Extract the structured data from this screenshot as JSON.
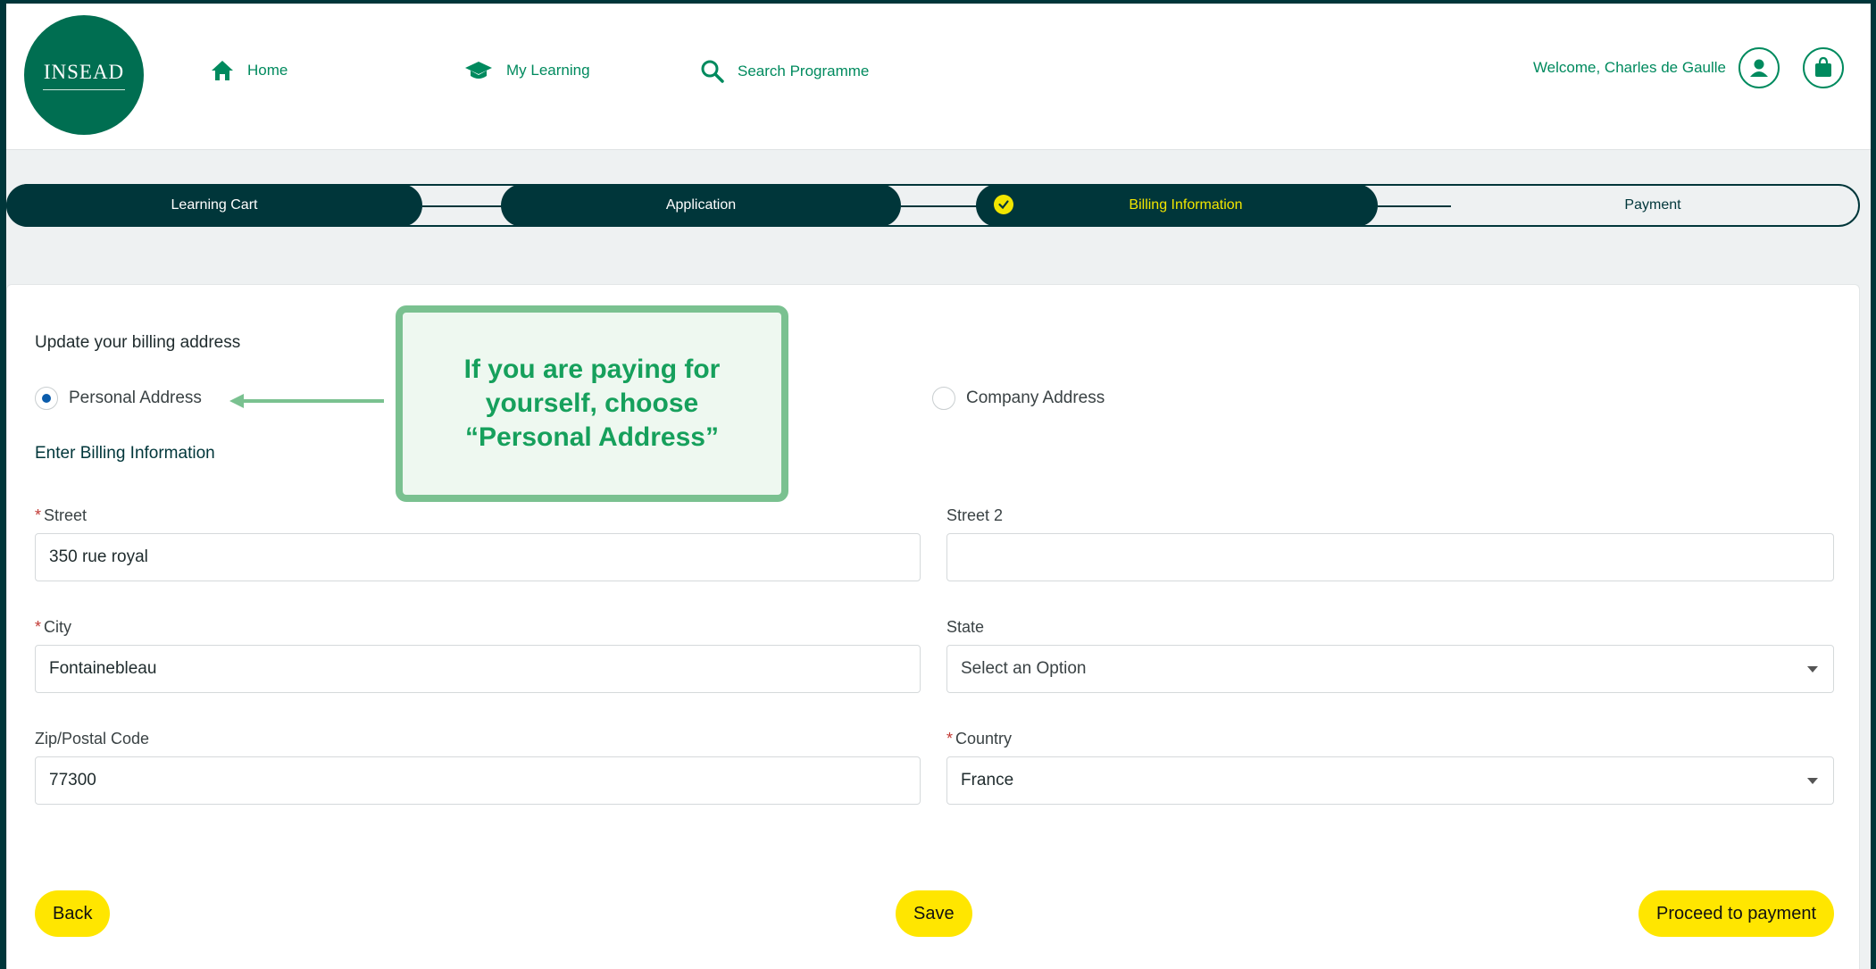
{
  "header": {
    "logo_text": "INSEAD",
    "nav": {
      "home": "Home",
      "my_learning": "My Learning",
      "search": "Search Programme"
    },
    "welcome": "Welcome, Charles de Gaulle"
  },
  "stepper": {
    "steps": [
      "Learning Cart",
      "Application",
      "Billing Information",
      "Payment"
    ],
    "active_index": 2
  },
  "form": {
    "title": "Update your billing address",
    "address_types": {
      "personal": "Personal Address",
      "company": "Company Address",
      "selected": "Personal Address"
    },
    "subtitle": "Enter Billing Information",
    "fields": {
      "street": {
        "label": "Street",
        "value": "350 rue royal",
        "required": true
      },
      "street2": {
        "label": "Street 2",
        "value": "",
        "required": false
      },
      "city": {
        "label": "City",
        "value": "Fontainebleau",
        "required": true
      },
      "state": {
        "label": "State",
        "value": "Select an Option",
        "required": false
      },
      "zip": {
        "label": "Zip/Postal Code",
        "value": "77300",
        "required": false
      },
      "country": {
        "label": "Country",
        "value": "France",
        "required": true
      }
    },
    "required_marker": "*"
  },
  "buttons": {
    "back": "Back",
    "save": "Save",
    "proceed": "Proceed to payment"
  },
  "callout": {
    "text": "If you are paying for yourself, choose “Personal Address”"
  },
  "colors": {
    "brand_dark": "#00363a",
    "brand_green": "#006e51",
    "link_green": "#008a5e",
    "accent_yellow": "#ffe600",
    "annotation_green": "#7ac190"
  }
}
